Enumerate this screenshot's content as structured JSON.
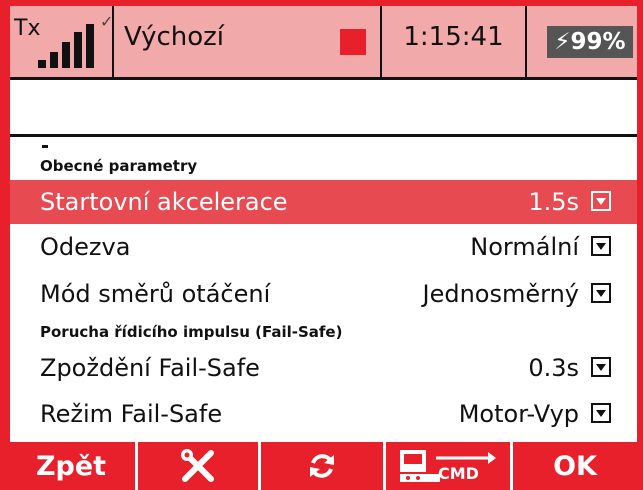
{
  "status_bar": {
    "tx_label": "Tx",
    "signal_bars": 5,
    "model_name": "Výchozí",
    "timer": "1:15:41",
    "battery": "⚡99%",
    "colors": {
      "bar_bg": "#f2a9aa",
      "record": "#e8202c",
      "battery_bg": "#555555"
    }
  },
  "sections": {
    "general": "Obecné parametry",
    "failsafe": "Porucha řídicího impulsu (Fail-Safe)"
  },
  "rows": [
    {
      "label": "Startovní akcelerace",
      "value": "1.5s",
      "selected": true
    },
    {
      "label": "Odezva",
      "value": "Normální",
      "selected": false
    },
    {
      "label": "Mód směrů otáčení",
      "value": "Jednosměrný",
      "selected": false
    },
    {
      "label": "Zpoždění Fail-Safe",
      "value": "0.3s",
      "selected": false
    },
    {
      "label": "Režim Fail-Safe",
      "value": "Motor-Vyp",
      "selected": false
    }
  ],
  "footer": {
    "back": "Zpět",
    "tools_icon": "wrench-screwdriver-icon",
    "refresh_icon": "refresh-icon",
    "cmd_icon": "receiver-cmd-icon",
    "cmd_text": "CMD",
    "ok": "OK"
  },
  "colors": {
    "accent": "#e8202c",
    "selected_row": "#e84a52"
  }
}
